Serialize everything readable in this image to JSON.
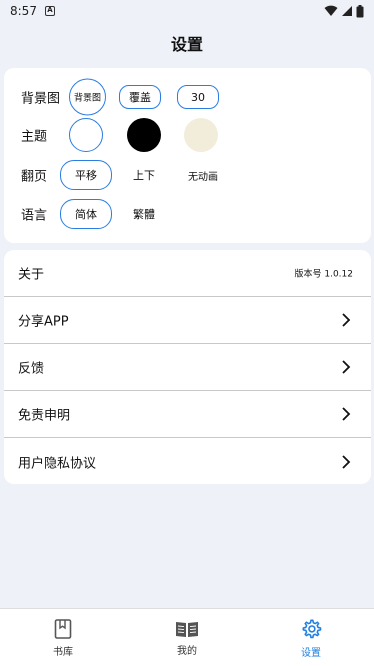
{
  "status": {
    "time": "8:57",
    "notif_glyph": "A"
  },
  "header": {
    "title": "设置"
  },
  "settings": {
    "background": {
      "label": "背景图",
      "options": [
        "背景图",
        "覆盖",
        "30"
      ]
    },
    "theme": {
      "label": "主题",
      "swatches": [
        "#ffffff",
        "#000000",
        "#f2ecda"
      ],
      "selected": 0
    },
    "flip": {
      "label": "翻页",
      "options": [
        "平移",
        "上下",
        "无动画"
      ],
      "selected": 0
    },
    "language": {
      "label": "语言",
      "options": [
        "简体",
        "繁體"
      ],
      "selected": 0
    }
  },
  "list": {
    "about": {
      "label": "关于",
      "value": "版本号 1.0.12"
    },
    "share": {
      "label": "分享APP"
    },
    "feedback": {
      "label": "反馈"
    },
    "disclaimer": {
      "label": "免责申明"
    },
    "privacy": {
      "label": "用户隐私协议"
    }
  },
  "tabs": {
    "library": "书库",
    "mine": "我的",
    "settings": "设置",
    "active": "settings",
    "active_color": "#1e7fe0"
  }
}
